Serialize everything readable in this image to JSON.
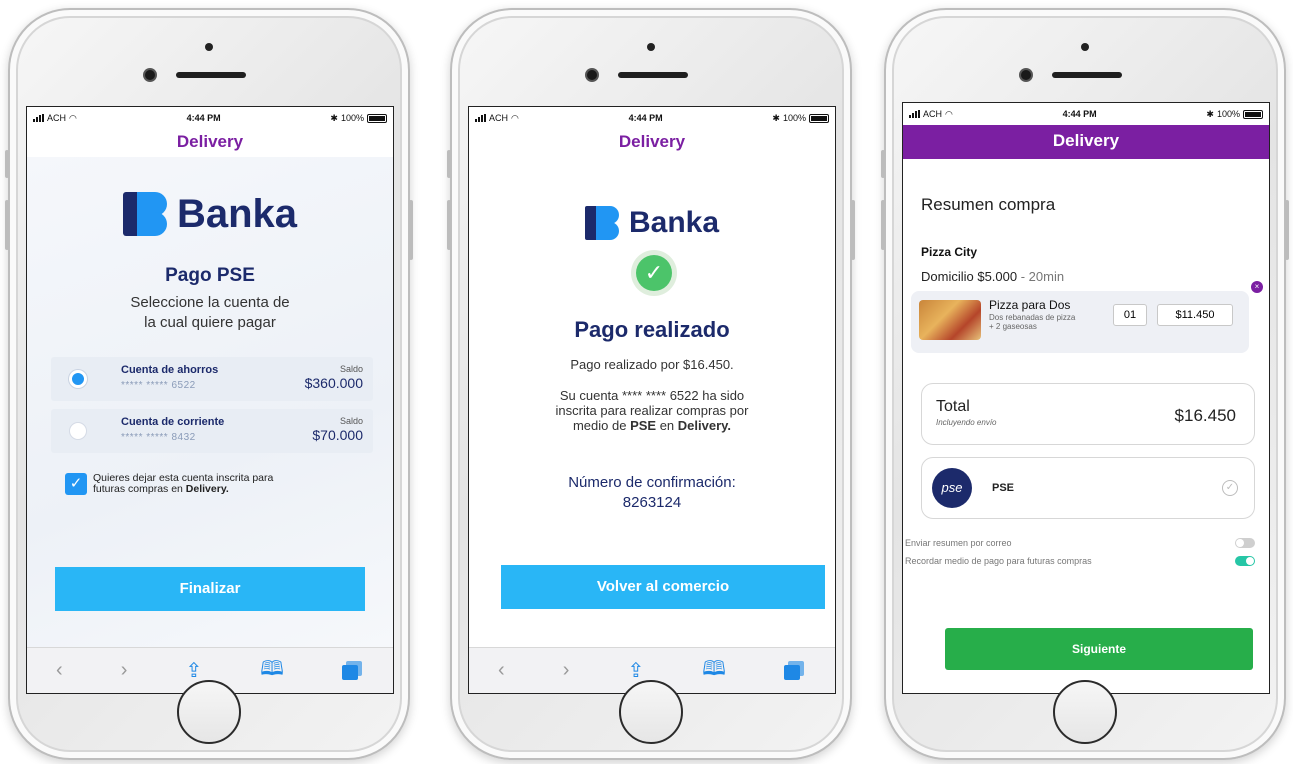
{
  "status_bar": {
    "carrier": "ACH",
    "time": "4:44 PM",
    "battery": "100%"
  },
  "app_title": "Delivery",
  "brand": {
    "name": "Banka"
  },
  "screen1": {
    "heading": "Pago PSE",
    "subtitle_line1": "Seleccione la cuenta de",
    "subtitle_line2": "la cual quiere pagar",
    "accounts": [
      {
        "name": "Cuenta de ahorros",
        "number": "***** ***** 6522",
        "balance_label": "Saldo",
        "balance": "$360.000",
        "selected": true
      },
      {
        "name": "Cuenta de corriente",
        "number": "***** ***** 8432",
        "balance_label": "Saldo",
        "balance": "$70.000",
        "selected": false
      }
    ],
    "checkbox_line1": "Quieres dejar esta cuenta inscrita para",
    "checkbox_line2_prefix": "futuras compras en ",
    "checkbox_line2_bold": "Delivery.",
    "button": "Finalizar"
  },
  "screen2": {
    "heading": "Pago realizado",
    "paid_text": "Pago realizado por $16.450.",
    "info_line1": "Su cuenta **** **** 6522 ha sido",
    "info_line2": "inscrita para realizar compras por",
    "info_line3_a": "medio de ",
    "info_line3_b": "PSE",
    "info_line3_c": " en ",
    "info_line3_d": "Delivery.",
    "confirm_label": "Número de confirmación:",
    "confirm_number": "8263124",
    "button": "Volver al comercio"
  },
  "screen3": {
    "title": "Resumen compra",
    "store": "Pizza City",
    "delivery_label": "Domicilio $5.000",
    "delivery_time": " - 20min",
    "item": {
      "name": "Pizza para Dos",
      "desc_line1": "Dos rebanadas de pizza",
      "desc_line2": "+ 2 gaseosas",
      "qty": "01",
      "price": "$11.450"
    },
    "total_label": "Total",
    "total_sub": "Incluyendo envío",
    "total_value": "$16.450",
    "payment_logo": "pse",
    "payment_name": "PSE",
    "option1": "Enviar resumen por correo",
    "option2": "Recordar medio de pago para futuras compras",
    "option1_on": false,
    "option2_on": true,
    "button": "Siguiente"
  },
  "colors": {
    "purple": "#7b1fa2",
    "navy": "#1c2a6b",
    "blue": "#29b6f6",
    "green": "#27ae4a",
    "teal": "#26c6a6"
  }
}
